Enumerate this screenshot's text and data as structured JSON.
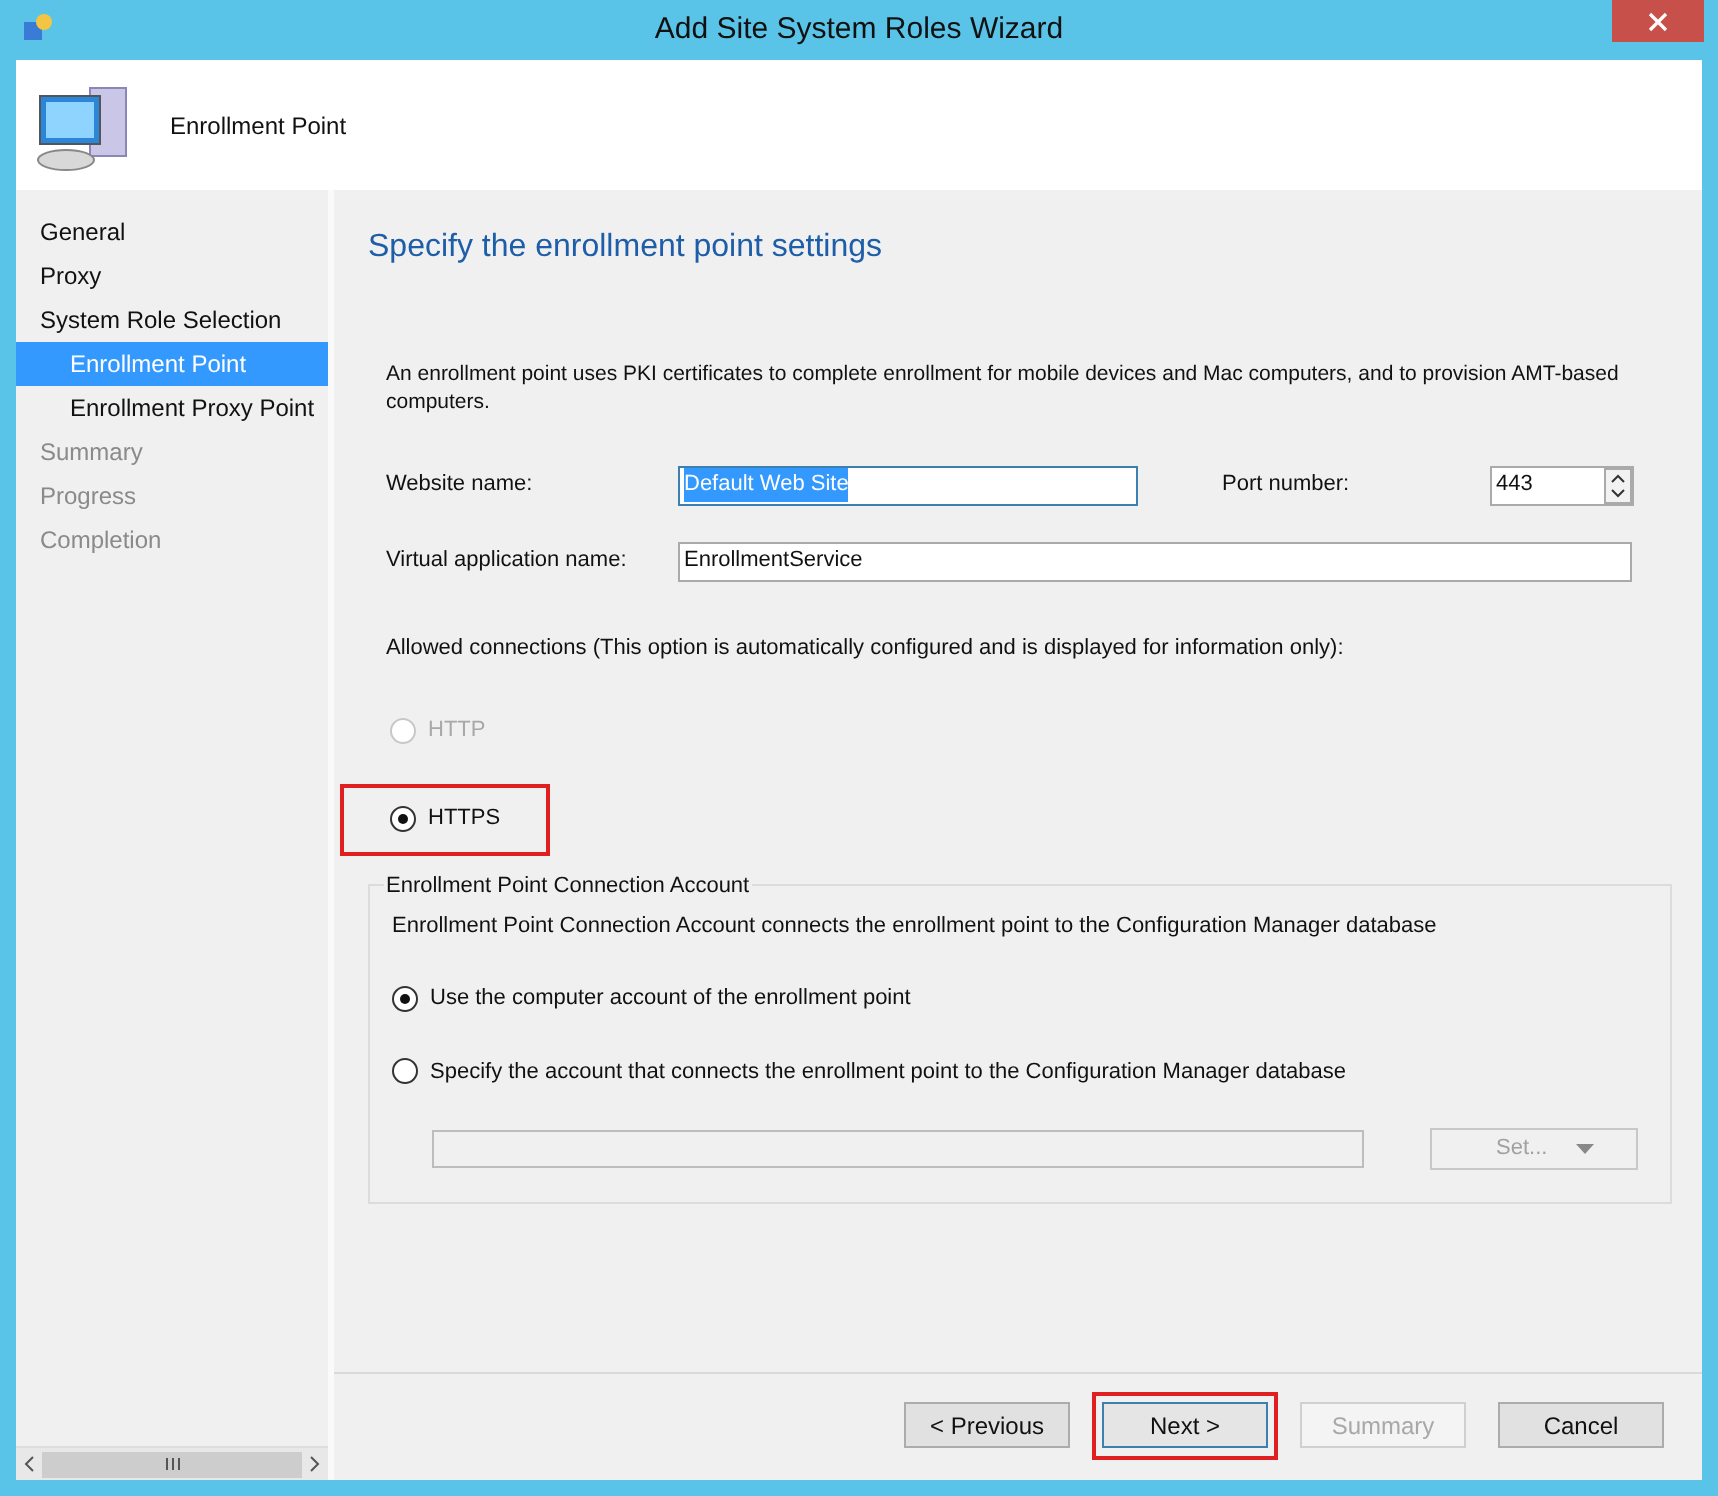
{
  "window": {
    "title": "Add Site System Roles Wizard"
  },
  "header": {
    "title": "Enrollment Point"
  },
  "sidebar": {
    "items": [
      {
        "label": "General",
        "selected": false,
        "disabled": false
      },
      {
        "label": "Proxy",
        "selected": false,
        "disabled": false
      },
      {
        "label": "System Role Selection",
        "selected": false,
        "disabled": false,
        "children": [
          {
            "label": "Enrollment Point",
            "selected": true,
            "disabled": false
          },
          {
            "label": "Enrollment Proxy Point",
            "selected": false,
            "disabled": false
          }
        ]
      },
      {
        "label": "Summary",
        "selected": false,
        "disabled": true
      },
      {
        "label": "Progress",
        "selected": false,
        "disabled": true
      },
      {
        "label": "Completion",
        "selected": false,
        "disabled": true
      }
    ]
  },
  "page": {
    "heading": "Specify the enrollment point settings",
    "description": "An enrollment point uses PKI certificates to complete enrollment for mobile devices and Mac computers, and to provision AMT-based computers.",
    "website_name": {
      "label": "Website name:",
      "value": "Default Web Site"
    },
    "port_number": {
      "label": "Port number:",
      "value": "443"
    },
    "virtual_application_name": {
      "label": "Virtual application name:",
      "value": "EnrollmentService"
    },
    "allowed_connections": {
      "label": "Allowed connections (This option is automatically configured and is displayed for information only):",
      "options": [
        {
          "label": "HTTP",
          "selected": false,
          "disabled": true,
          "highlighted": false
        },
        {
          "label": "HTTPS",
          "selected": true,
          "disabled": false,
          "highlighted": true
        }
      ]
    },
    "connection_account": {
      "title": "Enrollment Point Connection Account",
      "description": "Enrollment Point Connection Account connects the enrollment point to the Configuration Manager database",
      "options": [
        {
          "label": "Use the computer account of the enrollment point",
          "selected": true
        },
        {
          "label": "Specify the account that connects the enrollment point to the Configuration Manager database",
          "selected": false
        }
      ],
      "account_field": {
        "disabled": true
      },
      "set_button": {
        "label": "Set...",
        "disabled": true
      }
    }
  },
  "buttons": [
    {
      "label": "< Previous",
      "disabled": false,
      "highlighted": false
    },
    {
      "label": "Next >",
      "disabled": false,
      "highlighted": true
    },
    {
      "label": "Summary",
      "disabled": true,
      "highlighted": false
    },
    {
      "label": "Cancel",
      "disabled": false,
      "highlighted": false
    }
  ]
}
